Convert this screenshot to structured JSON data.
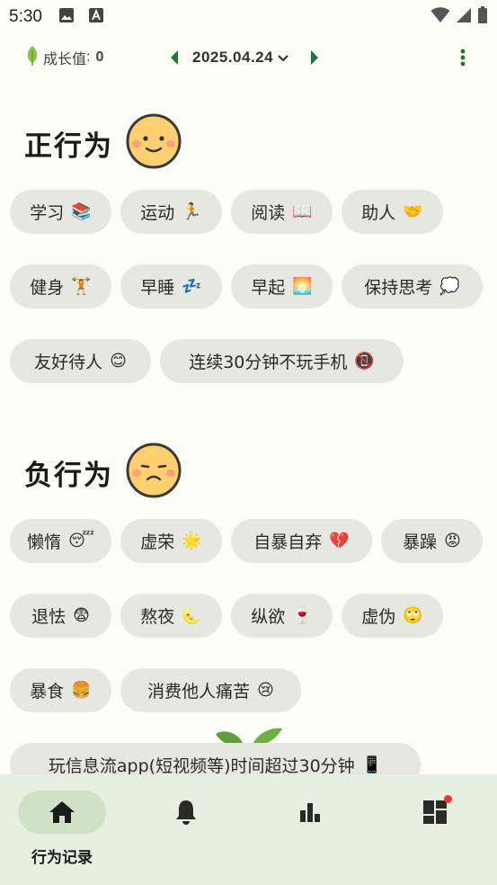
{
  "status_bar": {
    "time": "5:30"
  },
  "top_bar": {
    "growth_label": "成长值",
    "growth_separator": ":",
    "growth_value": "0",
    "date": "2025.04.24"
  },
  "positive": {
    "title": "正行为",
    "chips": [
      {
        "label": "学习",
        "emoji": "📚"
      },
      {
        "label": "运动",
        "emoji": "🏃"
      },
      {
        "label": "阅读",
        "emoji": "📖"
      },
      {
        "label": "助人",
        "emoji": "🤝"
      },
      {
        "label": "健身",
        "emoji": "🏋"
      },
      {
        "label": "早睡",
        "emoji": "💤"
      },
      {
        "label": "早起",
        "emoji": "🌅"
      },
      {
        "label": "保持思考",
        "emoji": "💭"
      },
      {
        "label": "友好待人",
        "emoji": "😊"
      },
      {
        "label": "连续30分钟不玩手机",
        "emoji": "📵"
      }
    ]
  },
  "negative": {
    "title": "负行为",
    "chips": [
      {
        "label": "懒惰",
        "emoji": "😴"
      },
      {
        "label": "虚荣",
        "emoji": "🌟"
      },
      {
        "label": "自暴自弃",
        "emoji": "💔"
      },
      {
        "label": "暴躁",
        "emoji": "😡"
      },
      {
        "label": "退怯",
        "emoji": "😨"
      },
      {
        "label": "熬夜",
        "emoji": "🌜"
      },
      {
        "label": "纵欲",
        "emoji": "🍷"
      },
      {
        "label": "虚伪",
        "emoji": "🙄"
      },
      {
        "label": "暴食",
        "emoji": "🍔"
      },
      {
        "label": "消费他人痛苦",
        "emoji": "😢"
      },
      {
        "label": "玩信息流app(短视频等)时间超过30分钟",
        "emoji": "📱"
      }
    ]
  },
  "bottom_nav": {
    "items": [
      {
        "label": "行为记录",
        "icon": "home-icon",
        "active": true
      },
      {
        "label": "",
        "icon": "bell-icon",
        "active": false
      },
      {
        "label": "",
        "icon": "bar-chart-icon",
        "active": false
      },
      {
        "label": "",
        "icon": "dashboard-icon",
        "active": false,
        "badge": true
      }
    ]
  },
  "colors": {
    "accent_green": "#1b7a2e",
    "chip_bg": "#e7e7e1",
    "nav_bg": "#e6efe0",
    "nav_active": "#cfe2c8",
    "badge": "#e53935"
  }
}
